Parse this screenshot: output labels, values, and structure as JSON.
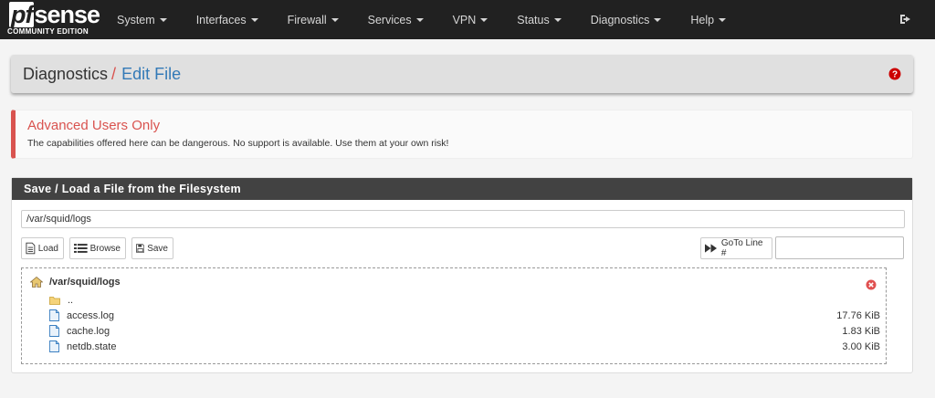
{
  "brand": {
    "logo_pf": "pf",
    "logo_rest": "sense",
    "edition": "COMMUNITY EDITION"
  },
  "nav": {
    "items": [
      {
        "label": "System"
      },
      {
        "label": "Interfaces"
      },
      {
        "label": "Firewall"
      },
      {
        "label": "Services"
      },
      {
        "label": "VPN"
      },
      {
        "label": "Status"
      },
      {
        "label": "Diagnostics"
      },
      {
        "label": "Help"
      }
    ],
    "logout_icon": "logout-icon"
  },
  "title": {
    "crumb1": "Diagnostics",
    "separator": "/",
    "crumb2": "Edit File",
    "help_icon": "question-circle-icon"
  },
  "alert": {
    "title": "Advanced Users Only",
    "text": "The capabilities offered here can be dangerous. No support is available. Use them at your own risk!"
  },
  "panel": {
    "heading": "Save / Load a File from the Filesystem",
    "path_value": "/var/squid/logs",
    "buttons": {
      "load": "Load",
      "browse": "Browse",
      "save": "Save",
      "goto": "GoTo Line #"
    },
    "goto_value": ""
  },
  "browser": {
    "current_dir": "/var/squid/logs",
    "parent": "..",
    "files": [
      {
        "name": "access.log",
        "size": "17.76 KiB"
      },
      {
        "name": "cache.log",
        "size": "1.83 KiB"
      },
      {
        "name": "netdb.state",
        "size": "3.00 KiB"
      }
    ]
  },
  "colors": {
    "navbar": "#212121",
    "accent_link": "#337ab7",
    "danger": "#d9534f",
    "panel_heading": "#424242"
  }
}
